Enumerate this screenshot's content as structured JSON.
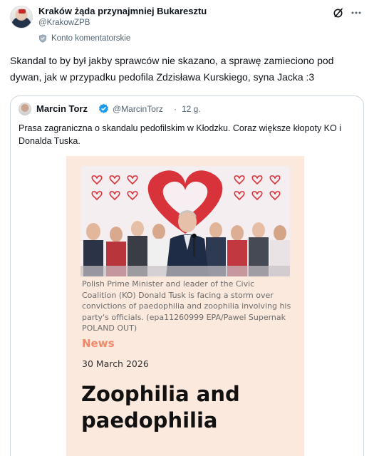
{
  "author": {
    "name": "Kraków żąda przynajmniej Bukaresztu",
    "handle": "@KrakowZPB",
    "account_label": "Konto komentatorskie"
  },
  "tweet": {
    "text": "Skandal to by był jakby sprawców nie skazano, a sprawę zamieciono pod dywan, jak w przypadku pedofila Zdzisława Kurskiego, syna Jacka :3"
  },
  "quoted": {
    "name": "Marcin Torz",
    "handle": "@MarcinTorz",
    "separator": "·",
    "time": "12 g.",
    "text": "Prasa zagraniczna o skandalu pedofilskim w Kłodzku. Coraz większe kłopoty KO i Donalda Tuska.",
    "article": {
      "caption": "Polish Prime Minister and leader of the Civic Coalition (KO) Donald Tusk is facing a storm over convictions of paedophilia and zoophilia involving his party's officials. (epa11260999 EPA/Pawel Supernak POLAND OUT)",
      "section": "News",
      "date": "30 March 2026",
      "headline": "Zoophilia and paedophilia"
    }
  },
  "icons": {
    "grok": "grok-icon",
    "more": "more-icon",
    "verified": "verified-badge-icon",
    "label": "shield-icon"
  },
  "colors": {
    "text_primary": "#0f1419",
    "text_secondary": "#536471",
    "verified_blue": "#1d9bf0",
    "article_bg": "#fbe9dd",
    "news_accent": "#f08a6b"
  }
}
